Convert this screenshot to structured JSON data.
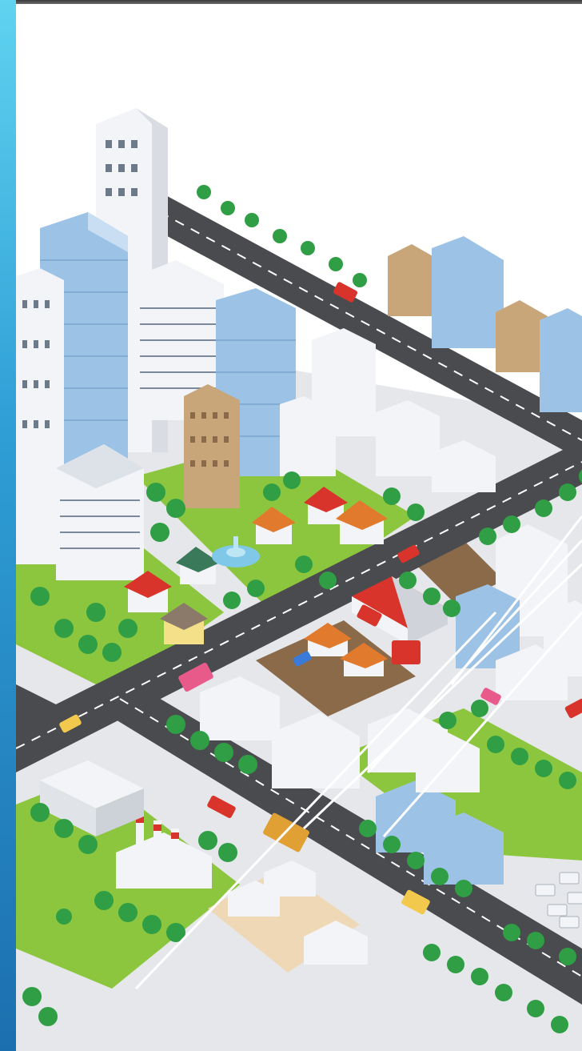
{
  "slide": {
    "accent_color": "#2f9fd6",
    "frame_color": "#4a4a4a"
  },
  "illustration": {
    "subject": "isometric-city-illustration",
    "palette": {
      "road": "#4a4b4f",
      "road_marking": "#ffffff",
      "grass": "#8cc63f",
      "tree": "#2f9e44",
      "building_glass": "#9cc3e6",
      "building_white": "#f2f4f7",
      "building_tan": "#c9a57a",
      "roof_red": "#d9342b",
      "roof_orange": "#e27a2e",
      "ground": "#e6e7ea"
    }
  }
}
